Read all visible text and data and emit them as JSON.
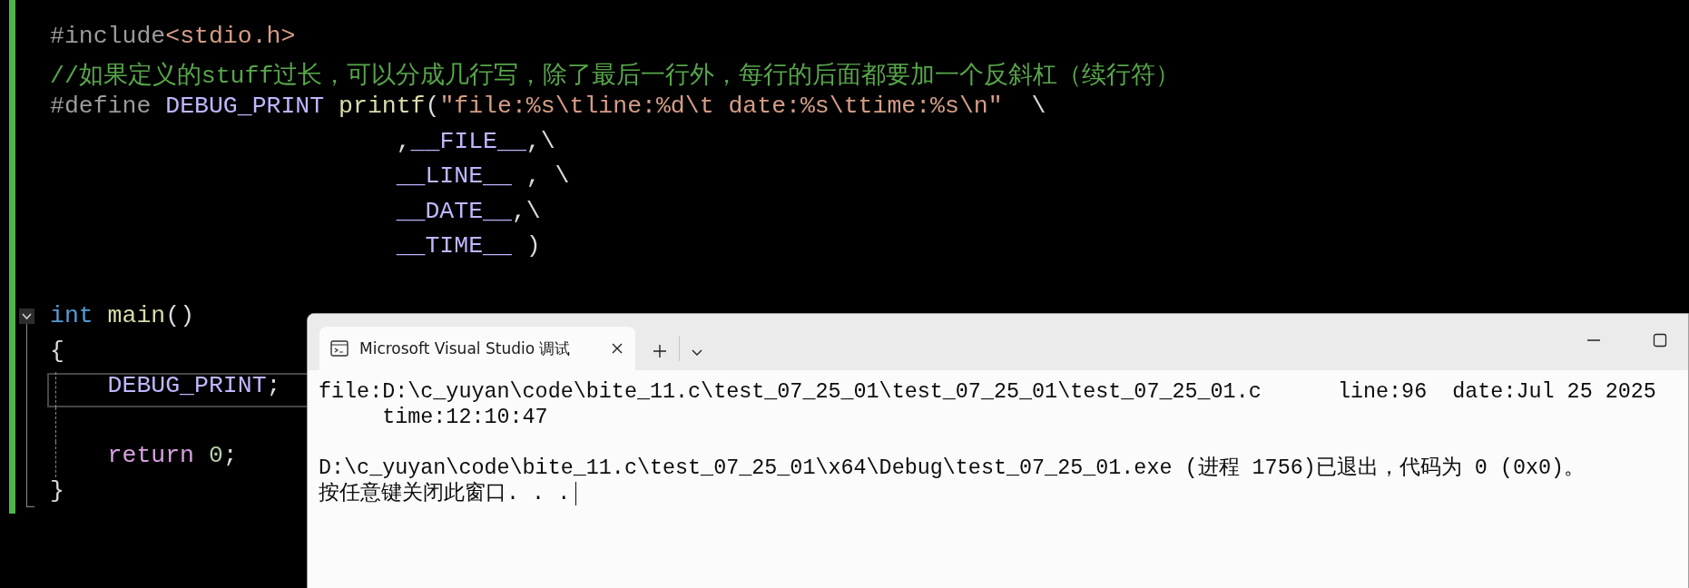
{
  "editor": {
    "lines": [
      {
        "current": false,
        "tokens": [
          {
            "text": "#include",
            "kind": "preprocessor"
          },
          {
            "text": "<stdio.h>",
            "kind": "string"
          }
        ]
      },
      {
        "current": false,
        "tokens": [
          {
            "text": "//如果定义的stuff过长，可以分成几行写，除了最后一行外，每行的后面都要加一个反斜杠（续行符）",
            "kind": "comment"
          }
        ]
      },
      {
        "current": false,
        "tokens": [
          {
            "text": "#define ",
            "kind": "preprocessor"
          },
          {
            "text": "DEBUG_PRINT",
            "kind": "macro"
          },
          {
            "text": " printf",
            "kind": "function"
          },
          {
            "text": "(",
            "kind": "plain"
          },
          {
            "text": "\"file:%s\\tline:%d\\t date:%s\\ttime:%s\\n\"",
            "kind": "string"
          },
          {
            "text": "  \\",
            "kind": "plain"
          }
        ]
      },
      {
        "current": false,
        "tokens": [
          {
            "text": "                        ,",
            "kind": "plain"
          },
          {
            "text": "__FILE__",
            "kind": "macro"
          },
          {
            "text": ",\\",
            "kind": "plain"
          }
        ]
      },
      {
        "current": false,
        "tokens": [
          {
            "text": "                        __LINE__",
            "kind": "macro"
          },
          {
            "text": " , \\",
            "kind": "plain"
          }
        ]
      },
      {
        "current": false,
        "tokens": [
          {
            "text": "                        __DATE__",
            "kind": "macro"
          },
          {
            "text": ",\\",
            "kind": "plain"
          }
        ]
      },
      {
        "current": false,
        "tokens": [
          {
            "text": "                        __TIME__",
            "kind": "macro"
          },
          {
            "text": " )",
            "kind": "plain"
          }
        ]
      },
      {
        "current": false,
        "blank_before": true,
        "expanded": true,
        "tokens": [
          {
            "text": "int",
            "kind": "keyword"
          },
          {
            "text": " main",
            "kind": "function"
          },
          {
            "text": "()",
            "kind": "plain"
          }
        ]
      },
      {
        "current": false,
        "tokens": [
          {
            "text": "{",
            "kind": "plain"
          }
        ]
      },
      {
        "current": true,
        "tokens": [
          {
            "text": "    DEBUG_PRINT",
            "kind": "macro"
          },
          {
            "text": ";",
            "kind": "plain"
          }
        ]
      },
      {
        "current": false,
        "blank_before": true,
        "tokens": [
          {
            "text": "    return",
            "kind": "control"
          },
          {
            "text": " 0",
            "kind": "number"
          },
          {
            "text": ";",
            "kind": "plain"
          }
        ]
      },
      {
        "current": false,
        "tokens": [
          {
            "text": "}",
            "kind": "plain"
          }
        ]
      }
    ]
  },
  "console": {
    "tab": {
      "title": "Microsoft Visual Studio 调试",
      "selected": true
    },
    "lines": [
      "file:D:\\c_yuyan\\code\\bite_11.c\\test_07_25_01\\test_07_25_01\\test_07_25_01.c      line:96  date:Jul 25 2025",
      "     time:12:10:47",
      "D:\\c_yuyan\\code\\bite_11.c\\test_07_25_01\\x64\\Debug\\test_07_25_01.exe (进程 1756)已退出，代码为 0 (0x0)。",
      "按任意键关闭此窗口. . ."
    ],
    "cursor": true
  }
}
